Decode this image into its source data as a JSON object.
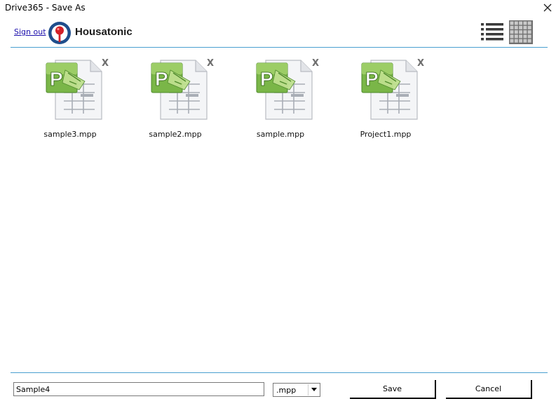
{
  "window": {
    "title": "Drive365 - Save As",
    "close_icon": "close-icon"
  },
  "header": {
    "sign_out_label": "Sign out",
    "brand_name": "Housatonic",
    "logo_icon": "housatonic-logo-icon",
    "view_icons": [
      "list-view-icon",
      "grid-view-icon"
    ]
  },
  "files": [
    {
      "name": "sample3.mpp",
      "remove_label": "X",
      "icon": "ms-project-file-icon"
    },
    {
      "name": "sample2.mpp",
      "remove_label": "X",
      "icon": "ms-project-file-icon"
    },
    {
      "name": "sample.mpp",
      "remove_label": "X",
      "icon": "ms-project-file-icon"
    },
    {
      "name": "Project1.mpp",
      "remove_label": "X",
      "icon": "ms-project-file-icon"
    }
  ],
  "footer": {
    "filename_value": "Sample4",
    "extension_selected": ".mpp",
    "save_label": "Save",
    "cancel_label": "Cancel"
  },
  "colors": {
    "divider": "#4a9fd0",
    "link": "#1a0dab",
    "project_green": "#6aa83a"
  }
}
